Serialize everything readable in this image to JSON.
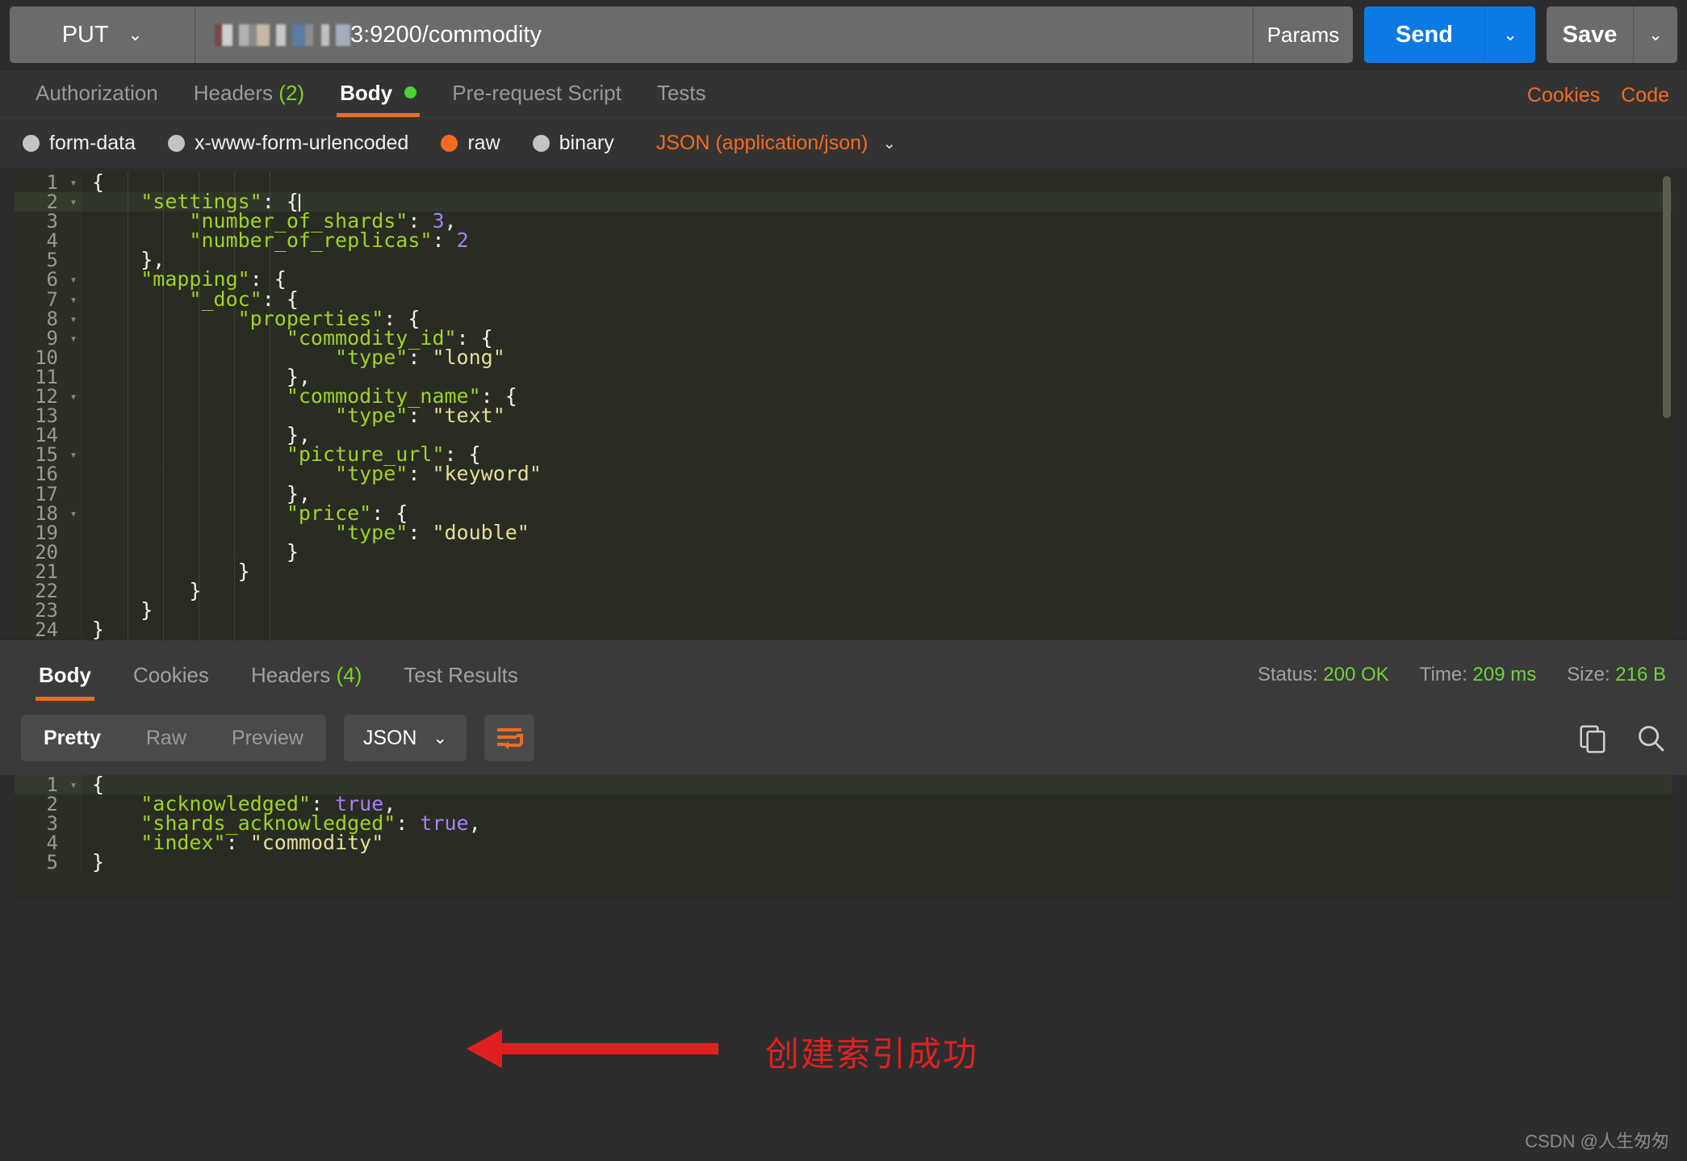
{
  "request_bar": {
    "method": "PUT",
    "method_caret": "⌄",
    "url_suffix": "3:9200/commodity",
    "url_redacted_note": "redacted-ip",
    "params_label": "Params",
    "send_label": "Send",
    "send_caret": "⌄",
    "save_label": "Save",
    "save_caret": "⌄"
  },
  "request_tabs": {
    "items": [
      {
        "label": "Authorization",
        "badge": "",
        "active": false
      },
      {
        "label": "Headers",
        "badge": "(2)",
        "active": false
      },
      {
        "label": "Body",
        "badge": "",
        "active": true,
        "dot": true
      },
      {
        "label": "Pre-request Script",
        "badge": "",
        "active": false
      },
      {
        "label": "Tests",
        "badge": "",
        "active": false
      }
    ],
    "cookies_link": "Cookies",
    "code_link": "Code"
  },
  "body_types": {
    "options": [
      {
        "label": "form-data",
        "selected": false
      },
      {
        "label": "x-www-form-urlencoded",
        "selected": false
      },
      {
        "label": "raw",
        "selected": true
      },
      {
        "label": "binary",
        "selected": false
      }
    ],
    "format": "JSON (application/json)",
    "format_caret": "⌄"
  },
  "request_body": {
    "lines": [
      {
        "n": "1",
        "fold": true,
        "highlight": false,
        "html": "<span class=\"p\">{</span>"
      },
      {
        "n": "2",
        "fold": true,
        "highlight": true,
        "html": "    <span class=\"k\">\"settings\"</span><span class=\"p\">: {</span><span class=\"caret-bar\"></span>"
      },
      {
        "n": "3",
        "fold": false,
        "highlight": false,
        "html": "        <span class=\"k\">\"number_of_shards\"</span><span class=\"p\">: </span><span class=\"n\">3</span><span class=\"p\">,</span>"
      },
      {
        "n": "4",
        "fold": false,
        "highlight": false,
        "html": "        <span class=\"k\">\"number_of_replicas\"</span><span class=\"p\">: </span><span class=\"n\">2</span>"
      },
      {
        "n": "5",
        "fold": false,
        "highlight": false,
        "html": "    <span class=\"p\">},</span>"
      },
      {
        "n": "6",
        "fold": true,
        "highlight": false,
        "html": "    <span class=\"k\">\"mapping\"</span><span class=\"p\">: {</span>"
      },
      {
        "n": "7",
        "fold": true,
        "highlight": false,
        "html": "        <span class=\"k\">\"_doc\"</span><span class=\"p\">: {</span>"
      },
      {
        "n": "8",
        "fold": true,
        "highlight": false,
        "html": "            <span class=\"k\">\"properties\"</span><span class=\"p\">: {</span>"
      },
      {
        "n": "9",
        "fold": true,
        "highlight": false,
        "html": "                <span class=\"k\">\"commodity_id\"</span><span class=\"p\">: {</span>"
      },
      {
        "n": "10",
        "fold": false,
        "highlight": false,
        "html": "                    <span class=\"k\">\"type\"</span><span class=\"p\">: </span><span class=\"s\">\"long\"</span>"
      },
      {
        "n": "11",
        "fold": false,
        "highlight": false,
        "html": "                <span class=\"p\">},</span>"
      },
      {
        "n": "12",
        "fold": true,
        "highlight": false,
        "html": "                <span class=\"k\">\"commodity_name\"</span><span class=\"p\">: {</span>"
      },
      {
        "n": "13",
        "fold": false,
        "highlight": false,
        "html": "                    <span class=\"k\">\"type\"</span><span class=\"p\">: </span><span class=\"s\">\"text\"</span>"
      },
      {
        "n": "14",
        "fold": false,
        "highlight": false,
        "html": "                <span class=\"p\">},</span>"
      },
      {
        "n": "15",
        "fold": true,
        "highlight": false,
        "html": "                <span class=\"k\">\"picture_url\"</span><span class=\"p\">: {</span>"
      },
      {
        "n": "16",
        "fold": false,
        "highlight": false,
        "html": "                    <span class=\"k\">\"type\"</span><span class=\"p\">: </span><span class=\"s\">\"keyword\"</span>"
      },
      {
        "n": "17",
        "fold": false,
        "highlight": false,
        "html": "                <span class=\"p\">},</span>"
      },
      {
        "n": "18",
        "fold": true,
        "highlight": false,
        "html": "                <span class=\"k\">\"price\"</span><span class=\"p\">: {</span>"
      },
      {
        "n": "19",
        "fold": false,
        "highlight": false,
        "html": "                    <span class=\"k\">\"type\"</span><span class=\"p\">: </span><span class=\"s\">\"double\"</span>"
      },
      {
        "n": "20",
        "fold": false,
        "highlight": false,
        "html": "                <span class=\"p\">}</span>"
      },
      {
        "n": "21",
        "fold": false,
        "highlight": false,
        "html": "            <span class=\"p\">}</span>"
      },
      {
        "n": "22",
        "fold": false,
        "highlight": false,
        "html": "        <span class=\"p\">}</span>"
      },
      {
        "n": "23",
        "fold": false,
        "highlight": false,
        "html": "    <span class=\"p\">}</span>"
      },
      {
        "n": "24",
        "fold": false,
        "highlight": false,
        "html": "<span class=\"p\">}</span>"
      }
    ]
  },
  "response_tabs": {
    "items": [
      {
        "label": "Body",
        "badge": "",
        "active": true
      },
      {
        "label": "Cookies",
        "badge": "",
        "active": false
      },
      {
        "label": "Headers",
        "badge": "(4)",
        "active": false
      },
      {
        "label": "Test Results",
        "badge": "",
        "active": false
      }
    ],
    "status_label": "Status:",
    "status_value": "200 OK",
    "time_label": "Time:",
    "time_value": "209 ms",
    "size_label": "Size:",
    "size_value": "216 B"
  },
  "response_toolbar": {
    "segments": [
      {
        "label": "Pretty",
        "active": true
      },
      {
        "label": "Raw",
        "active": false
      },
      {
        "label": "Preview",
        "active": false
      }
    ],
    "format": "JSON",
    "format_caret": "⌄"
  },
  "response_body": {
    "lines": [
      {
        "n": "1",
        "fold": true,
        "highlight": true,
        "html": "<span class=\"p\">{</span>"
      },
      {
        "n": "2",
        "fold": false,
        "highlight": false,
        "html": "    <span class=\"k\">\"acknowledged\"</span><span class=\"p\">: </span><span class=\"b\">true</span><span class=\"p\">,</span>"
      },
      {
        "n": "3",
        "fold": false,
        "highlight": false,
        "html": "    <span class=\"k\">\"shards_acknowledged\"</span><span class=\"p\">: </span><span class=\"b\">true</span><span class=\"p\">,</span>"
      },
      {
        "n": "4",
        "fold": false,
        "highlight": false,
        "html": "    <span class=\"k\">\"index\"</span><span class=\"p\">: </span><span class=\"s\">\"commodity\"</span>"
      },
      {
        "n": "5",
        "fold": false,
        "highlight": false,
        "html": "<span class=\"p\">}</span>"
      }
    ]
  },
  "annotation": {
    "text": "创建索引成功",
    "color": "#e02020"
  },
  "watermark": "CSDN @人生匆匆",
  "colors": {
    "accent_orange": "#f26b21",
    "send_blue": "#0b7ae5",
    "status_green": "#6fd43a",
    "json_key_green": "#9fd326",
    "json_string_yellow": "#e8dd98",
    "json_value_purple": "#ab7df8",
    "annotation_red": "#e02020"
  }
}
